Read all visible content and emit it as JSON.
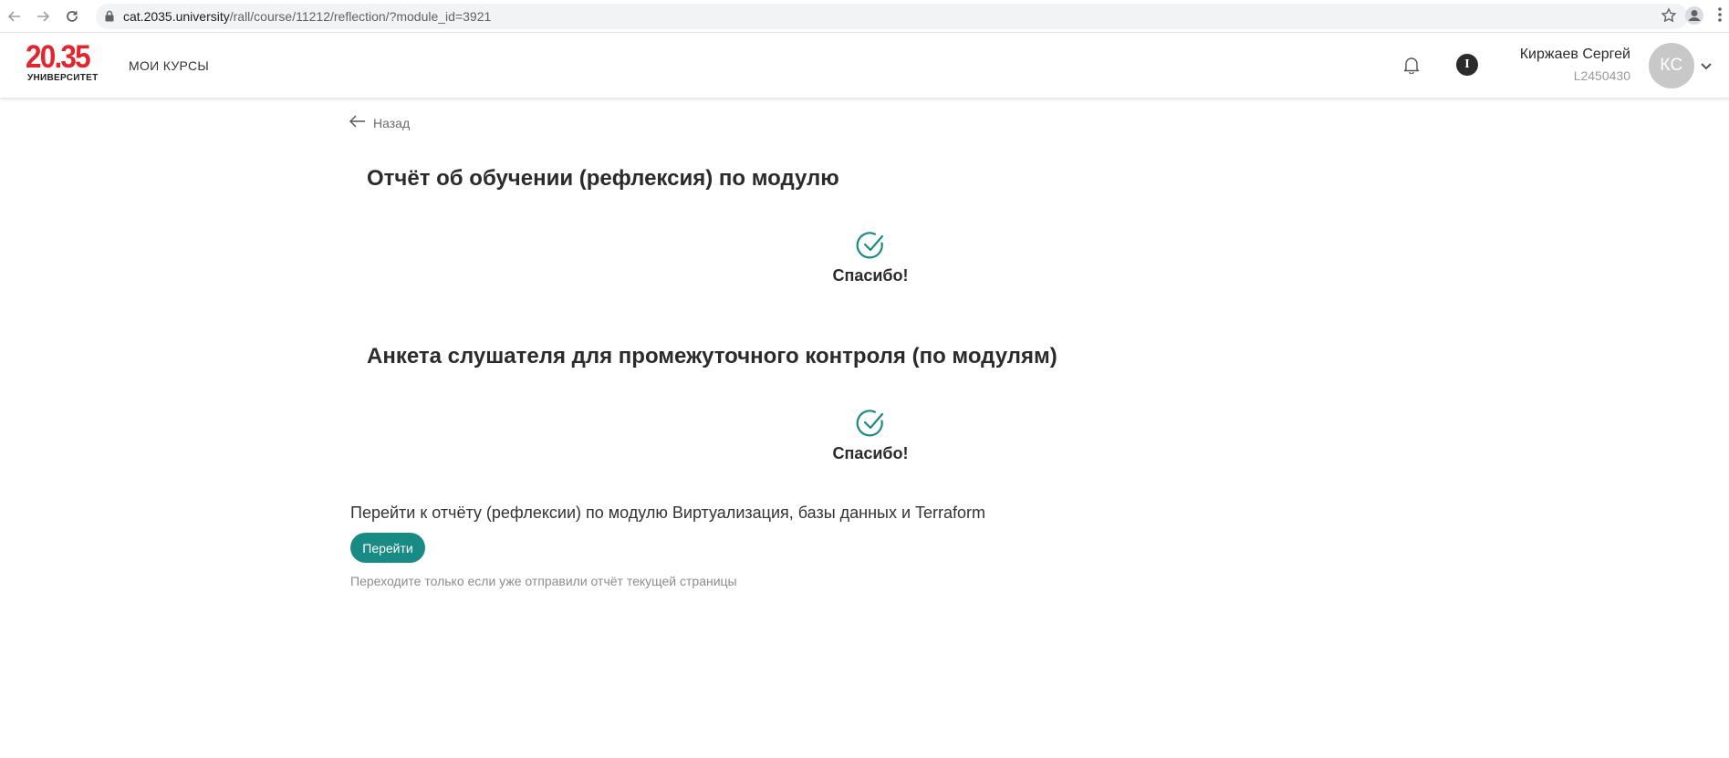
{
  "browser": {
    "url_host": "cat.2035.university",
    "url_path": "/rall/course/11212/reflection/?module_id=3921",
    "icons": [
      "back-icon",
      "forward-icon",
      "reload-icon",
      "lock-icon",
      "bookmark-star-icon",
      "profile-icon",
      "kebab-menu-icon"
    ]
  },
  "header": {
    "logo_number": "20.35",
    "logo_subtitle": "УНИВЕРСИТЕТ",
    "nav_my_courses": "МОИ КУРСЫ",
    "info_label": "I",
    "user_name": "Киржаев Сергей",
    "user_id": "L2450430",
    "avatar_initials": "КС",
    "colors": {
      "logo_red": "#e0262e",
      "avatar_bg": "#c8c8c8"
    }
  },
  "main": {
    "back_label": "Назад",
    "sections": [
      {
        "title": "Отчёт об обучении (рефлексия) по модулю",
        "status": "Спасибо!"
      },
      {
        "title": "Анкета слушателя для промежуточного контроля (по модулям)",
        "status": "Спасибо!"
      }
    ],
    "goto_text": "Перейти к отчёту (рефлексии) по модулю Виртуализация, базы данных и Terraform",
    "goto_button": "Перейти",
    "hint": "Переходите только если уже отправили отчёт текущей страницы",
    "colors": {
      "accent": "#1a8a85"
    }
  }
}
